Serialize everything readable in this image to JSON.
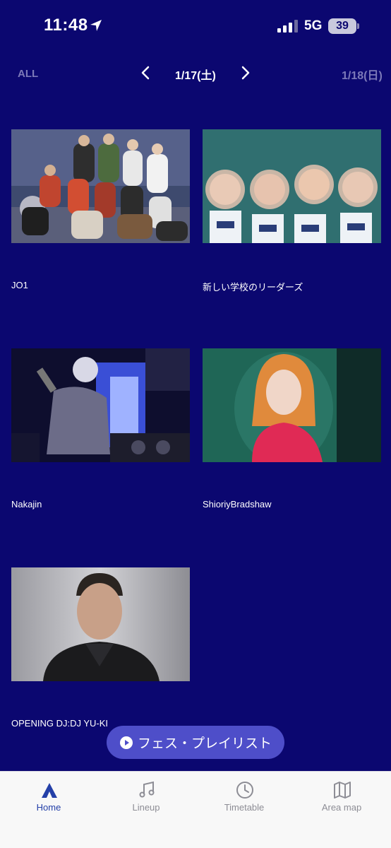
{
  "status_bar": {
    "time": "11:48",
    "network": "5G",
    "battery": "39"
  },
  "date_nav": {
    "all_label": "ALL",
    "current_date": "1/17(土)",
    "other_date": "1/18(日)"
  },
  "artists": [
    {
      "name": "JO1",
      "image": "group-photo"
    },
    {
      "name": "新しい学校のリーダーズ",
      "image": "group-photo"
    },
    {
      "name": "Nakajin",
      "image": "dj-performance-photo"
    },
    {
      "name": "ShioriyBradshaw",
      "image": "portrait-photo"
    },
    {
      "name": "OPENING DJ:DJ YU-KI",
      "image": "portrait-photo"
    }
  ],
  "playlist_button": {
    "label": "フェス・プレイリスト",
    "icon": "play-circle-icon"
  },
  "tab_bar": {
    "tabs": [
      {
        "label": "Home",
        "icon": "home-icon",
        "active": true
      },
      {
        "label": "Lineup",
        "icon": "music-note-icon",
        "active": false
      },
      {
        "label": "Timetable",
        "icon": "clock-icon",
        "active": false
      },
      {
        "label": "Area map",
        "icon": "map-icon",
        "active": false
      }
    ]
  },
  "colors": {
    "background": "#0b0770",
    "tab_active": "#2440a8",
    "tab_inactive": "#8d8d95",
    "playlist_button": "#4e4ec9",
    "nav_dim": "#7c79b8"
  }
}
